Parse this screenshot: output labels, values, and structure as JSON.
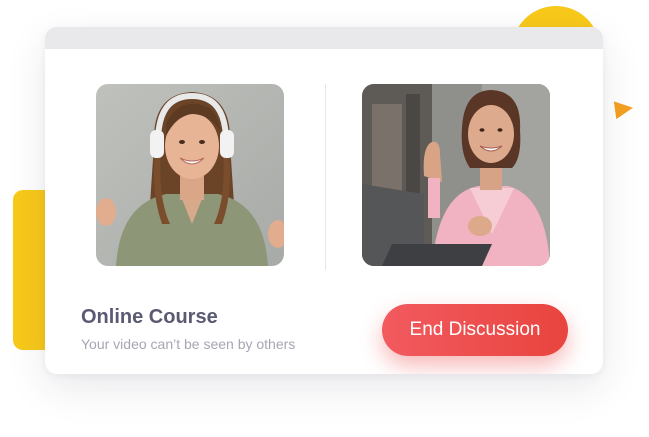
{
  "course": {
    "title": "Online Course",
    "subtitle": "Your video can’t be seen by others"
  },
  "actions": {
    "end_label": "End Discussion"
  },
  "colors": {
    "accent_yellow": "#f8c91a",
    "accent_orange": "#f5a020",
    "button_red": "#ee4d4d",
    "title_text": "#5a5a72",
    "muted_text": "#a6a6b4"
  },
  "participants": [
    {
      "role": "student",
      "photo": "woman-with-headphones-waving"
    },
    {
      "role": "instructor",
      "photo": "older-woman-waving-at-laptop"
    }
  ]
}
